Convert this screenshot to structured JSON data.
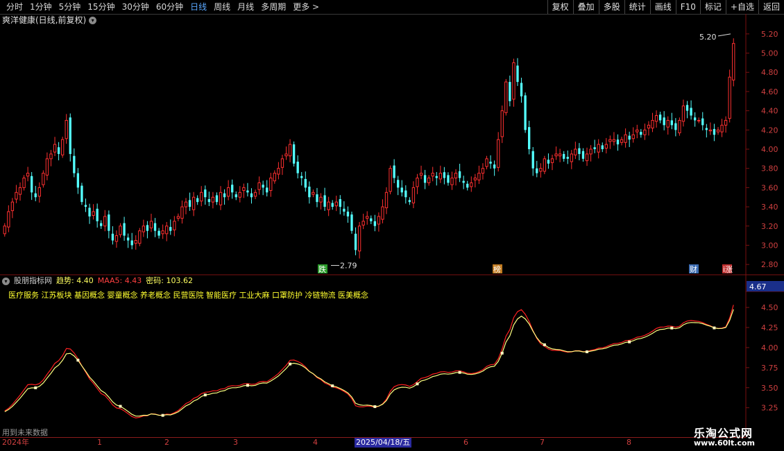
{
  "toolbar": {
    "periods": [
      "分时",
      "1分钟",
      "5分钟",
      "15分钟",
      "30分钟",
      "60分钟",
      "日线",
      "周线",
      "月线",
      "多周期",
      "更多 >"
    ],
    "active_period": "日线",
    "right_buttons": [
      "复权",
      "叠加",
      "多股",
      "统计",
      "画线",
      "F10",
      "标记",
      "+自选",
      "返回"
    ]
  },
  "main": {
    "title": "爽洋健康(日线,前复权)",
    "price_axis": [
      "5.20",
      "5.00",
      "4.80",
      "4.60",
      "4.40",
      "4.20",
      "4.00",
      "3.80",
      "3.60",
      "3.40",
      "3.20",
      "3.00",
      "2.80"
    ],
    "high_label": "5.20",
    "low_label": "2.79",
    "markers": [
      {
        "text": "跌",
        "color": "#2a9a2a"
      },
      {
        "text": "榜",
        "color": "#c07a20"
      },
      {
        "text": "财",
        "color": "#3a6ab0"
      },
      {
        "text": "i涨",
        "color": "#c03030"
      }
    ]
  },
  "indicator": {
    "name": "股朋指标网",
    "trend_label": "趋势: 4.40",
    "maa_label": "MAA5: 4.43",
    "code_label": "密码: 103.62",
    "tags": "医疗服务 江苏板块 基因概念 婴童概念 养老概念 民营医院 智能医疗 工业大麻 口罩防护 冷链物流 医美概念",
    "axis": [
      "4.50",
      "4.25",
      "4.00",
      "3.75",
      "3.50",
      "3.25"
    ],
    "current_value": "4.67",
    "future_note": "用到未来数据"
  },
  "time_axis": {
    "labels": [
      "2024年",
      "1",
      "2",
      "3",
      "4",
      "6",
      "7",
      "8"
    ],
    "selected": "2025/04/18/五"
  },
  "watermark": {
    "name": "乐淘公式网",
    "url": "www.60lt.com"
  },
  "colors": {
    "up": "#ff3030",
    "down": "#54ffff",
    "trend": "#ffff80",
    "maa": "#ff2020",
    "grid": "#7a1010"
  },
  "chart_data": {
    "type": "candlestick",
    "y_range": [
      2.7,
      5.3
    ],
    "close": [
      3.2,
      3.35,
      3.45,
      3.55,
      3.6,
      3.7,
      3.75,
      3.55,
      3.5,
      3.6,
      3.75,
      3.9,
      3.95,
      4.05,
      3.95,
      4.1,
      4.3,
      3.95,
      3.75,
      3.6,
      3.45,
      3.4,
      3.3,
      3.35,
      3.25,
      3.2,
      3.3,
      3.15,
      3.05,
      3.1,
      3.2,
      3.1,
      3.05,
      3.0,
      3.05,
      3.15,
      3.2,
      3.15,
      3.25,
      3.15,
      3.1,
      3.15,
      3.2,
      3.15,
      3.25,
      3.3,
      3.4,
      3.45,
      3.4,
      3.5,
      3.45,
      3.55,
      3.5,
      3.45,
      3.5,
      3.45,
      3.55,
      3.5,
      3.6,
      3.55,
      3.5,
      3.55,
      3.6,
      3.55,
      3.5,
      3.55,
      3.65,
      3.6,
      3.55,
      3.7,
      3.75,
      3.8,
      3.9,
      3.95,
      4.05,
      3.85,
      3.75,
      3.7,
      3.6,
      3.5,
      3.55,
      3.45,
      3.5,
      3.4,
      3.45,
      3.4,
      3.45,
      3.4,
      3.35,
      3.3,
      3.15,
      2.95,
      3.2,
      3.25,
      3.3,
      3.25,
      3.2,
      3.3,
      3.4,
      3.55,
      3.8,
      3.7,
      3.6,
      3.55,
      3.5,
      3.45,
      3.6,
      3.7,
      3.75,
      3.65,
      3.7,
      3.75,
      3.7,
      3.75,
      3.7,
      3.65,
      3.7,
      3.75,
      3.7,
      3.65,
      3.6,
      3.65,
      3.7,
      3.75,
      3.8,
      3.9,
      3.85,
      3.8,
      4.1,
      4.4,
      4.7,
      4.5,
      4.9,
      4.7,
      4.55,
      4.2,
      4.0,
      3.8,
      3.75,
      3.8,
      3.9,
      3.85,
      3.9,
      3.95,
      3.95,
      3.9,
      3.9,
      3.95,
      4.0,
      3.95,
      3.9,
      3.95,
      4.0,
      4.0,
      4.05,
      4.0,
      4.05,
      4.1,
      4.1,
      4.05,
      4.1,
      4.15,
      4.1,
      4.15,
      4.2,
      4.15,
      4.2,
      4.25,
      4.3,
      4.35,
      4.3,
      4.25,
      4.3,
      4.25,
      4.2,
      4.3,
      4.45,
      4.4,
      4.35,
      4.3,
      4.3,
      4.25,
      4.2,
      4.2,
      4.15,
      4.2,
      4.25,
      4.3,
      4.75,
      5.1
    ]
  }
}
